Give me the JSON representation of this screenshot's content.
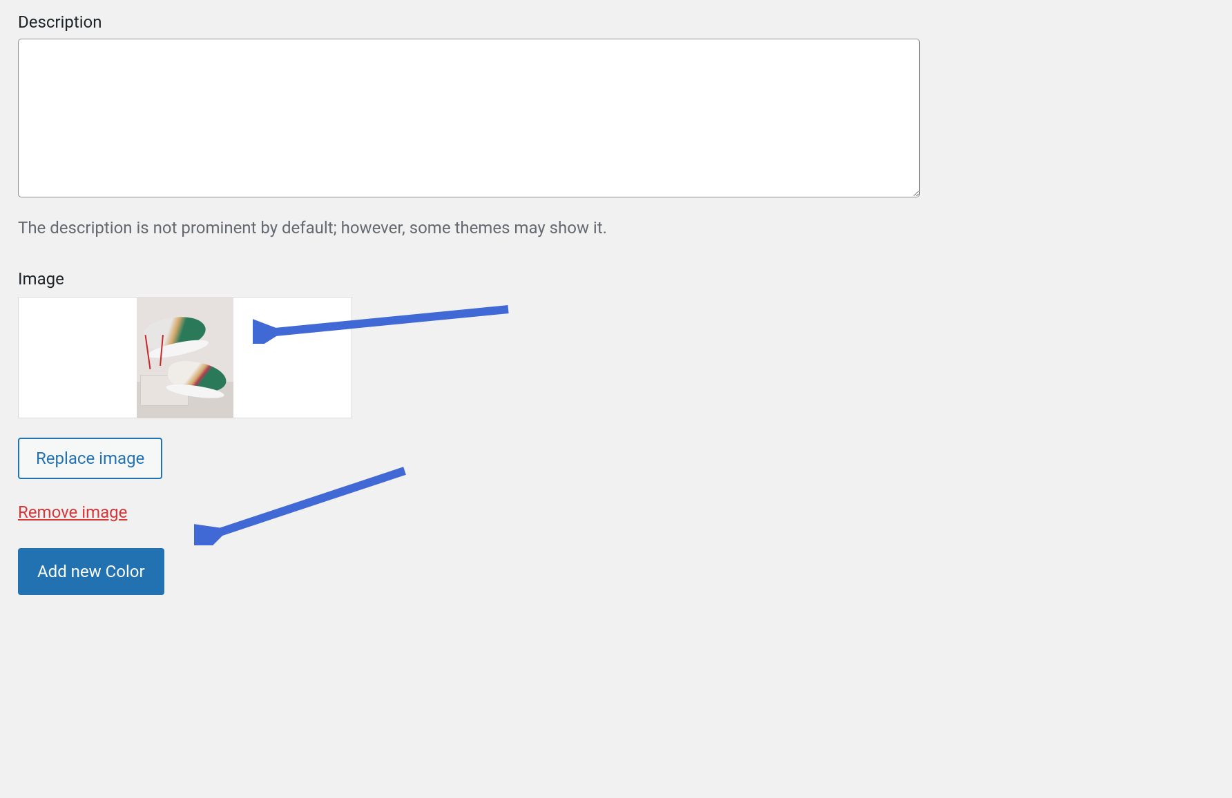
{
  "description": {
    "label": "Description",
    "value": "",
    "helper": "The description is not prominent by default; however, some themes may show it."
  },
  "image": {
    "label": "Image",
    "replace_button": "Replace image",
    "remove_link": "Remove image"
  },
  "submit": {
    "add_button": "Add new Color"
  },
  "colors": {
    "link_blue": "#2271b1",
    "danger_red": "#d63638",
    "arrow_blue": "#4169d6"
  }
}
